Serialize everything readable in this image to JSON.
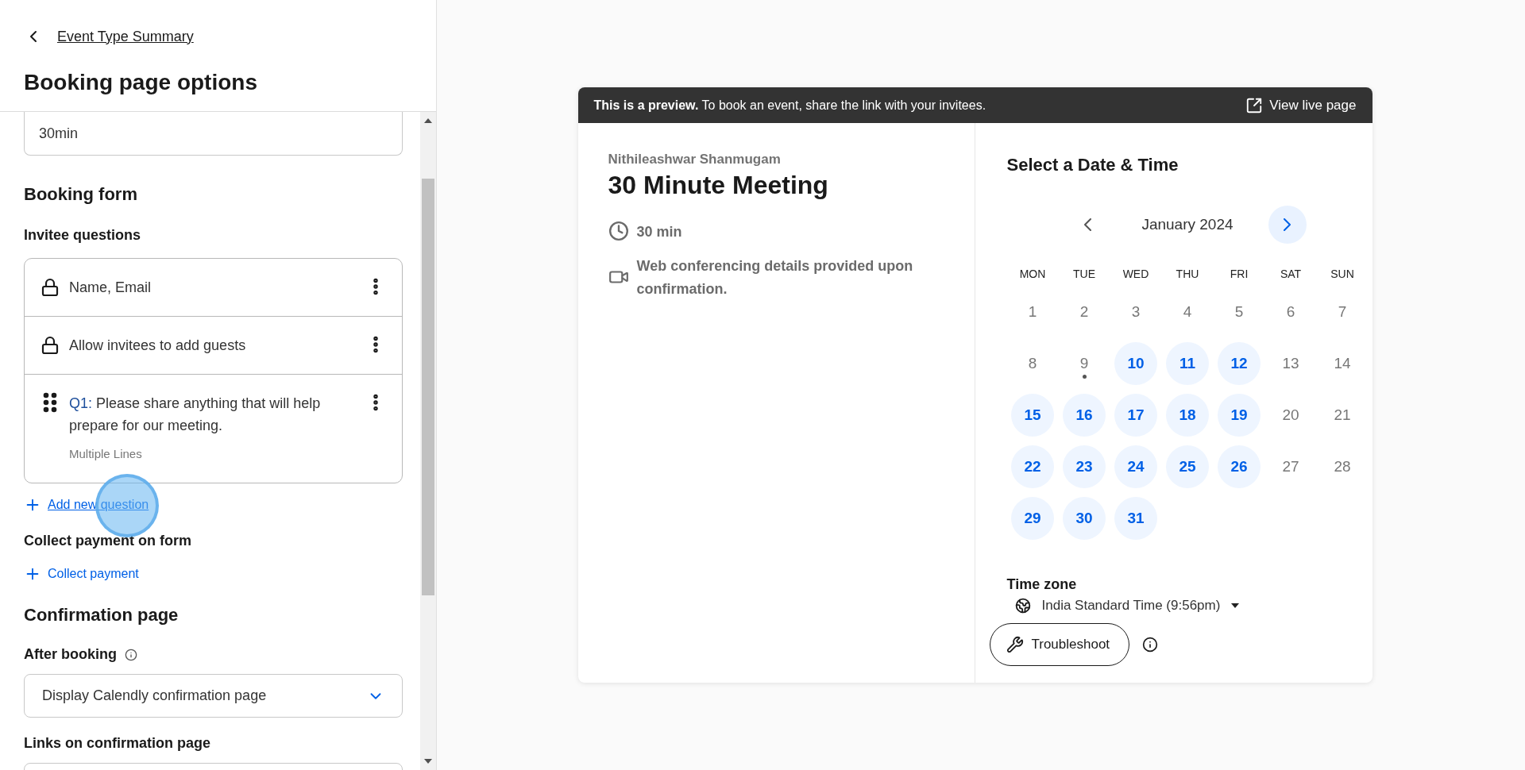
{
  "sidebar": {
    "back_link": "Event Type Summary",
    "title": "Booking page options",
    "event_link_field": {
      "value": "30min"
    },
    "booking_form": {
      "heading": "Booking form",
      "questions_heading": "Invitee questions",
      "questions": [
        {
          "kind": "locked",
          "text": "Name, Email"
        },
        {
          "kind": "locked",
          "text": "Allow invitees to add guests"
        },
        {
          "kind": "custom",
          "label": "Q1:",
          "text": "Please share anything that will help prepare for our meeting.",
          "type": "Multiple Lines"
        }
      ],
      "add_question": "Add new question",
      "payment_heading": "Collect payment on form",
      "collect_payment": "Collect payment"
    },
    "confirmation": {
      "heading": "Confirmation page",
      "after_booking": "After booking",
      "after_booking_select": "Display Calendly confirmation page",
      "links_heading": "Links on confirmation page"
    }
  },
  "preview": {
    "banner": "**This is a preview.** To book an event, share the link with your invitees.",
    "view_live": "View live page",
    "host": "Nithileashwar Shanmugam",
    "event_title": "30 Minute Meeting",
    "duration": "30 min",
    "location": "Web conferencing details provided upon confirmation.",
    "calendar": {
      "title": "Select a Date & Time",
      "month": "January 2024",
      "weekdays": [
        "MON",
        "TUE",
        "WED",
        "THU",
        "FRI",
        "SAT",
        "SUN"
      ],
      "days": [
        {
          "day": "1",
          "available": false,
          "today": false
        },
        {
          "day": "2",
          "available": false,
          "today": false
        },
        {
          "day": "3",
          "available": false,
          "today": false
        },
        {
          "day": "4",
          "available": false,
          "today": false
        },
        {
          "day": "5",
          "available": false,
          "today": false
        },
        {
          "day": "6",
          "available": false,
          "today": false
        },
        {
          "day": "7",
          "available": false,
          "today": false
        },
        {
          "day": "8",
          "available": false,
          "today": false
        },
        {
          "day": "9",
          "available": false,
          "today": true
        },
        {
          "day": "10",
          "available": true,
          "today": false
        },
        {
          "day": "11",
          "available": true,
          "today": false
        },
        {
          "day": "12",
          "available": true,
          "today": false
        },
        {
          "day": "13",
          "available": false,
          "today": false
        },
        {
          "day": "14",
          "available": false,
          "today": false
        },
        {
          "day": "15",
          "available": true,
          "today": false
        },
        {
          "day": "16",
          "available": true,
          "today": false
        },
        {
          "day": "17",
          "available": true,
          "today": false
        },
        {
          "day": "18",
          "available": true,
          "today": false
        },
        {
          "day": "19",
          "available": true,
          "today": false
        },
        {
          "day": "20",
          "available": false,
          "today": false
        },
        {
          "day": "21",
          "available": false,
          "today": false
        },
        {
          "day": "22",
          "available": true,
          "today": false
        },
        {
          "day": "23",
          "available": true,
          "today": false
        },
        {
          "day": "24",
          "available": true,
          "today": false
        },
        {
          "day": "25",
          "available": true,
          "today": false
        },
        {
          "day": "26",
          "available": true,
          "today": false
        },
        {
          "day": "27",
          "available": false,
          "today": false
        },
        {
          "day": "28",
          "available": false,
          "today": false
        },
        {
          "day": "29",
          "available": true,
          "today": false
        },
        {
          "day": "30",
          "available": true,
          "today": false
        },
        {
          "day": "31",
          "available": true,
          "today": false
        }
      ]
    },
    "timezone_heading": "Time zone",
    "timezone": "India Standard Time (9:56pm)",
    "troubleshoot": "Troubleshoot"
  }
}
